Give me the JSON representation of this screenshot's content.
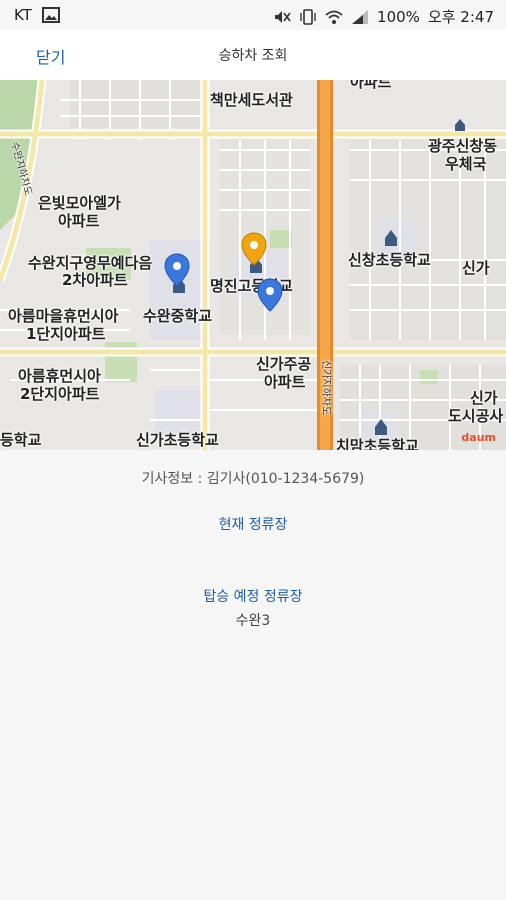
{
  "status_bar": {
    "carrier": "KT",
    "battery": "100%",
    "time": "오후 2:47"
  },
  "header": {
    "close_label": "닫기",
    "title": "승하차 조회"
  },
  "map": {
    "labels": [
      "책만세도서관",
      "광주신창동",
      "우체국",
      "은빛모아엘가",
      "아파트",
      "수완지구영무예다음",
      "2차아파트",
      "아름마을휴먼시아",
      "1단지아파트",
      "아름휴먼시아",
      "2단지아파트",
      "수완중학교",
      "명진고등학교",
      "신창초등학교",
      "신가주공",
      "아파트",
      "신가초등학교",
      "신가",
      "도시공사",
      "신가",
      "등학교",
      "치맘초등학교",
      "아파트",
      "수완지하차도",
      "신가지하차도"
    ],
    "logo": "daum"
  },
  "info": {
    "driver": "기사정보 : 김기사(010-1234-5679)",
    "current_stop_label": "현재 정류장",
    "next_stop_label": "탑승 예정 정류장",
    "next_stop_value": "수완3"
  }
}
